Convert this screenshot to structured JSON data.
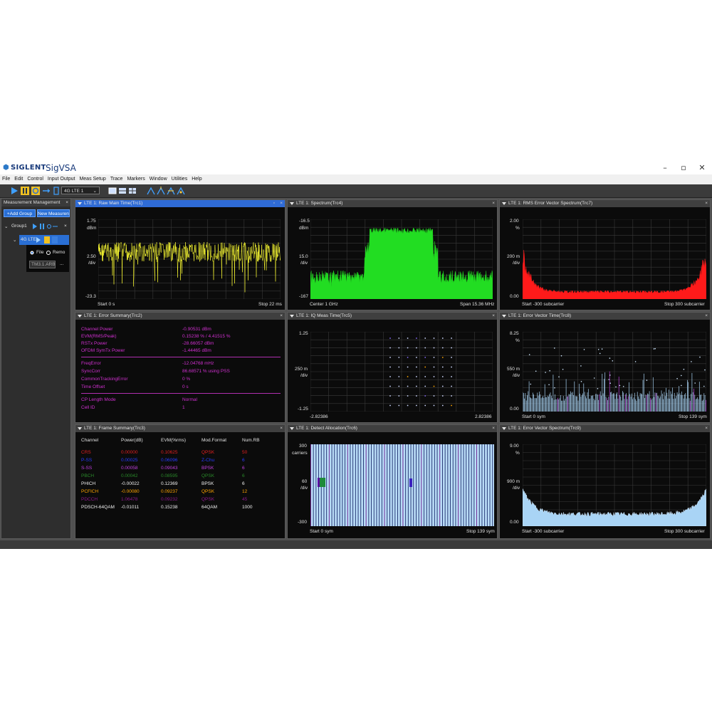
{
  "app": {
    "brand": "SIGLENT",
    "name": "SigVSA",
    "window_controls": [
      "–",
      "▫",
      "✕"
    ]
  },
  "menu": [
    "File",
    "Edit",
    "Control",
    "Input Output",
    "Meas Setup",
    "Trace",
    "Markers",
    "Window",
    "Utilities",
    "Help"
  ],
  "toolbar": {
    "measurement_select": "4G LTE 1"
  },
  "sidebar": {
    "title": "Measurement Management",
    "add_group": "Add Group",
    "new_measurement": "New Measuren",
    "group_label": "Group1",
    "meas_label": "4G LTE",
    "source_file": "File",
    "source_remote": "Remo",
    "file_name": "TM3.1.ARB",
    "file_browse": "..."
  },
  "panels": {
    "trc1": {
      "title": "LTE 1: Raw Main Time(Trc1)",
      "top": "1.75",
      "unit": "dBm",
      "mid": "2.50",
      "div": "/div",
      "bottom": "-23.3",
      "start": "Start  0 s",
      "stop": "Stop  22 ms"
    },
    "trc4": {
      "title": "LTE 1: Spectrum(Trc4)",
      "top": "-16.5",
      "unit": "dBm",
      "mid": "15.0",
      "div": "/div",
      "bottom": "-167",
      "start": "Center  1 GHz",
      "stop": "Span  15.36 MHz"
    },
    "trc7": {
      "title": "LTE 1: RMS Error Vector Spectrum(Trc7)",
      "top": "2.00",
      "unit": "%",
      "mid": "200 m",
      "div": "/div",
      "bottom": "0.00",
      "start": "Start  -300 subcarrier",
      "stop": "Stop  300 subcarrier"
    },
    "trc2": {
      "title": "LTE 1: Error Summary(Trc2)",
      "rows_a": [
        {
          "name": "Channel Power",
          "value": "-0.90531 dBm"
        },
        {
          "name": "EVM(RMS/Peak)",
          "value": "0.15238 % / 4.41515 %"
        },
        {
          "name": "RSTx Power",
          "value": "-28.66057 dBm"
        },
        {
          "name": "OFDM SymTx Power",
          "value": "-1.44465 dBm"
        }
      ],
      "rows_b": [
        {
          "name": "FreqError",
          "value": "-12.04768 mHz"
        },
        {
          "name": "SyncCorr",
          "value": "86.68571 %   using PSS"
        },
        {
          "name": "CommonTrackingError",
          "value": "0 %"
        },
        {
          "name": "Time Offset",
          "value": "0 s"
        }
      ],
      "rows_c": [
        {
          "name": "CP Length Mode",
          "value": "Normal"
        },
        {
          "name": "Cell ID",
          "value": "1"
        }
      ]
    },
    "trc5": {
      "title": "LTE 1: IQ Meas Time(Trc5)",
      "top": "1.25",
      "mid": "250 m",
      "div": "/div",
      "bottom": "-1.25",
      "start": "-2.82386",
      "stop": "2.82386"
    },
    "trc8": {
      "title": "LTE 1: Error Vector Time(Trc8)",
      "top": "8.25",
      "unit": "%",
      "mid": "550 m",
      "div": "/div",
      "bottom": "0.00",
      "start": "Start  0 sym",
      "stop": "Stop  139 sym"
    },
    "trc3": {
      "title": "LTE 1: Frame Summary(Trc3)",
      "headers": [
        "Channel",
        "Power(dB)",
        "EVM(%rms)",
        "Mod.Format",
        "Num.RB"
      ],
      "rows": [
        {
          "channel": "CRS",
          "power": "0.00000",
          "evm": "0.10625",
          "mod": "QPSK",
          "rb": "50",
          "color": "#e02020"
        },
        {
          "channel": "P-SS",
          "power": "0.00025",
          "evm": "0.06096",
          "mod": "Z-Chu",
          "rb": "6",
          "color": "#2a3cff"
        },
        {
          "channel": "S-SS",
          "power": "0.00058",
          "evm": "0.09043",
          "mod": "BPSK",
          "rb": "6",
          "color": "#c040e0"
        },
        {
          "channel": "PBCH",
          "power": "0.00042",
          "evm": "0.08595",
          "mod": "QPSK",
          "rb": "6",
          "color": "#2a8a2a"
        },
        {
          "channel": "PHICH",
          "power": "-0.00022",
          "evm": "0.12369",
          "mod": "BPSK",
          "rb": "6",
          "color": "#f0f0f0"
        },
        {
          "channel": "PCFICH",
          "power": "-0.00080",
          "evm": "0.09237",
          "mod": "QPSK",
          "rb": "12",
          "color": "#ffa500"
        },
        {
          "channel": "PDCCH",
          "power": "1.06478",
          "evm": "0.09232",
          "mod": "QPSK",
          "rb": "45",
          "color": "#8a1a8a"
        },
        {
          "channel": "PDSCH-64QAM",
          "power": "-0.01011",
          "evm": "0.15238",
          "mod": "64QAM",
          "rb": "1000",
          "color": "#f0f0f0"
        }
      ]
    },
    "trc6": {
      "title": "LTE 1: Detect Allocation(Trc6)",
      "top": "300",
      "unit": "carriers",
      "mid": "60",
      "div": "/div",
      "bottom": "-300",
      "start": "Start  0 sym",
      "stop": "Stop  139 sym"
    },
    "trc9": {
      "title": "LTE 1: Error Vector Spectrum(Trc9)",
      "top": "9.00",
      "unit": "%",
      "mid": "900 m",
      "div": "/div",
      "bottom": "0.00",
      "start": "Start  -300 subcarrier",
      "stop": "Stop  300 subcarrier"
    }
  },
  "colors": {
    "trace_time": "#ffff33",
    "trace_spectrum": "#22dd22",
    "trace_rms": "#ff1a1a",
    "trace_ev": "#a9d4f5",
    "summary_text": "#d030d0",
    "accent": "#2f6bd6"
  }
}
